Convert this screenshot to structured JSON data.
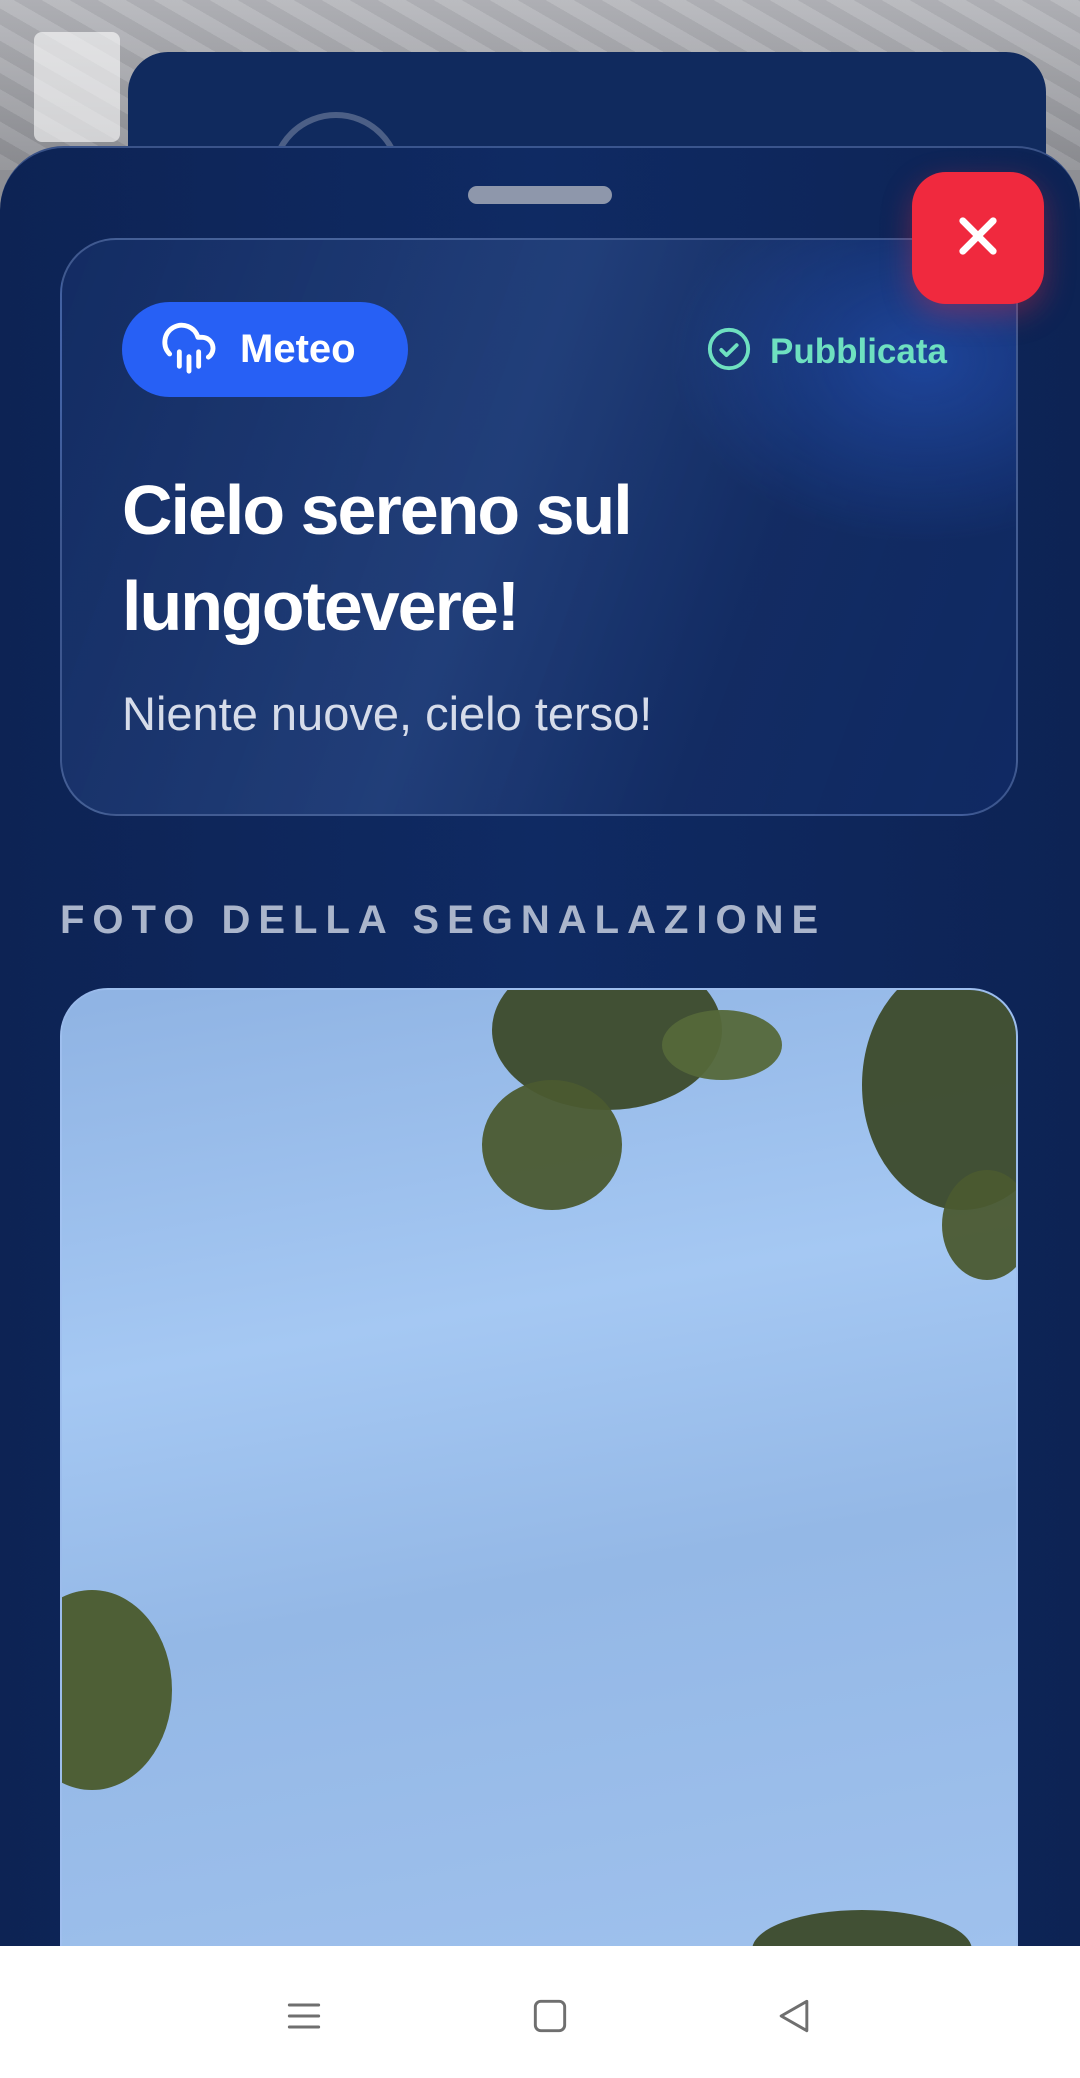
{
  "sheet": {
    "category": {
      "label": "Meteo",
      "icon": "cloud-rain-icon",
      "color": "#2760f5"
    },
    "status": {
      "label": "Pubblicata",
      "icon": "check-circle-icon",
      "color": "#6ee0c0"
    },
    "title": "Cielo sereno sul lungotevere!",
    "description": "Niente nuove, cielo terso!",
    "photo_section_title": "FOTO DELLA SEGNALAZIONE",
    "close_icon": "close-icon",
    "close_color": "#f0293e"
  },
  "navbar": {
    "items": [
      {
        "icon": "menu-icon"
      },
      {
        "icon": "home-square-icon"
      },
      {
        "icon": "back-triangle-icon"
      }
    ]
  }
}
